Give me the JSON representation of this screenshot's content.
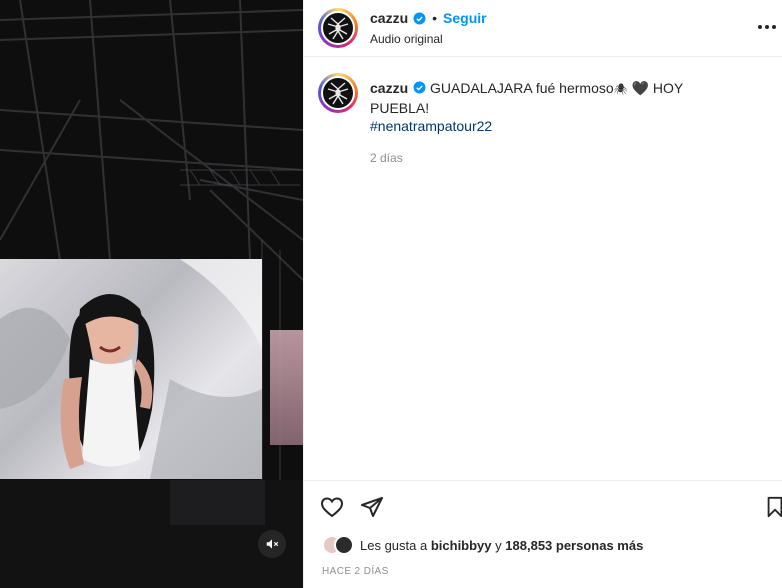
{
  "post": {
    "author": "cazzu",
    "header_separator": "•",
    "follow_label": "Seguir",
    "audio": "Audio original",
    "caption": {
      "username": "cazzu",
      "text_1": "GUADALAJARA fué hermoso",
      "emoji_1": "🕷",
      "emoji_2": "🖤",
      "text_2": "HOY PUEBLA!",
      "hashtag": "#nenatrampatour22",
      "relative_time": "2 días"
    },
    "likes": {
      "prefix": "Les gusta a",
      "user": "bichibbyy",
      "connector": "y",
      "count": "188,853 personas más"
    },
    "date": "HACE 2 DÍAS"
  },
  "icons": {
    "verified": "verified-badge-icon",
    "like": "heart-icon",
    "share": "paper-plane-icon",
    "save": "bookmark-icon",
    "mute": "speaker-muted-icon",
    "more": "more-dots-icon"
  },
  "colors": {
    "accent": "#0095f6",
    "hashtag": "#00376b",
    "muted_text": "#8e8e8e",
    "border": "#efefef"
  }
}
